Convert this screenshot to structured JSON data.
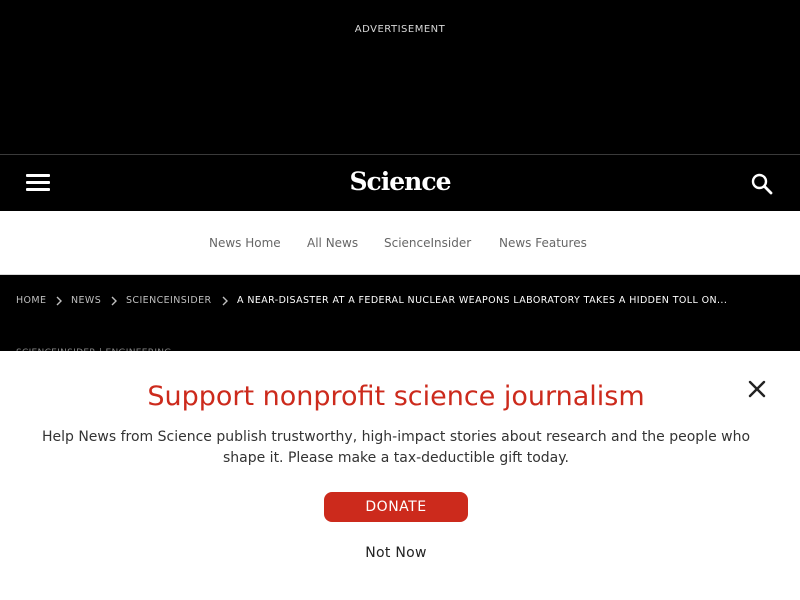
{
  "ad": {
    "label": "ADVERTISEMENT"
  },
  "header": {
    "logo_text": "Science",
    "menu_icon": "hamburger-menu-icon",
    "search_icon": "search-icon"
  },
  "subnav": {
    "items": [
      {
        "label": "News Home"
      },
      {
        "label": "All News"
      },
      {
        "label": "ScienceInsider"
      },
      {
        "label": "News Features"
      }
    ]
  },
  "breadcrumb": {
    "items": [
      {
        "label": "HOME"
      },
      {
        "label": "NEWS"
      },
      {
        "label": "SCIENCEINSIDER"
      },
      {
        "label": "A NEAR-DISASTER AT A FEDERAL NUCLEAR WEAPONS LABORATORY TAKES A HIDDEN TOLL ON..."
      }
    ]
  },
  "article_meta": {
    "partial_text": "SCIENCEINSIDER | ENGINEERING"
  },
  "modal": {
    "title": "Support nonprofit science journalism",
    "body": "Help News from Science publish trustworthy, high-impact stories about research and the people who shape it. Please make a tax-deductible gift today.",
    "donate_label": "DONATE",
    "not_now_label": "Not Now",
    "close_icon": "close-icon"
  },
  "colors": {
    "accent": "#cc2a1c",
    "dark_bg": "#000000"
  }
}
